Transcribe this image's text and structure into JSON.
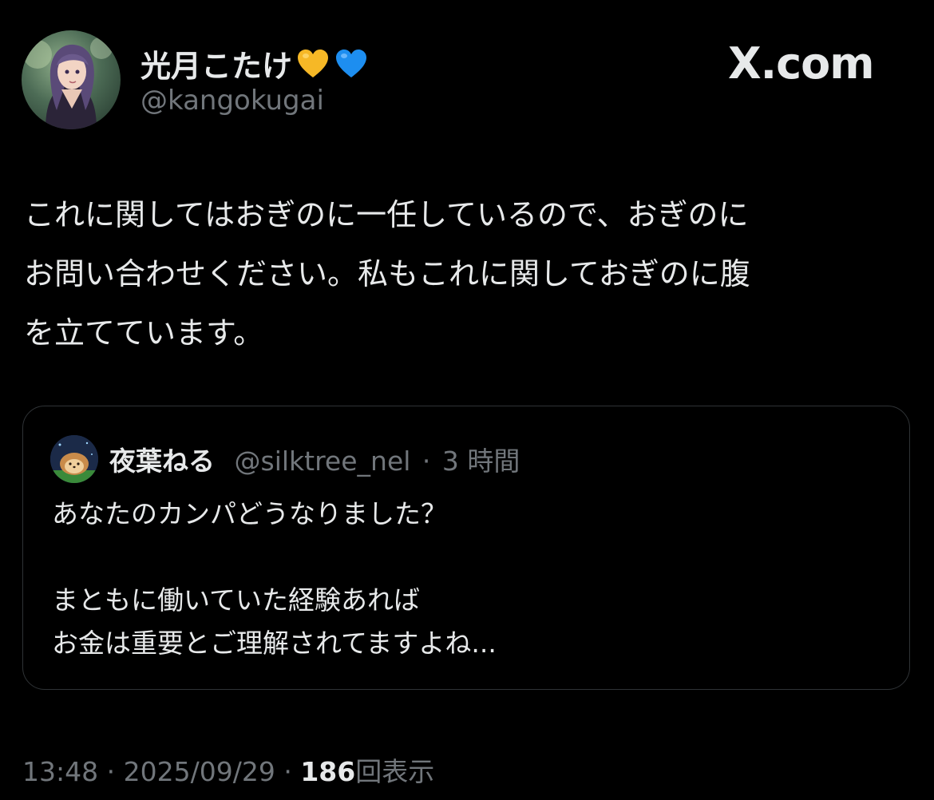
{
  "author": {
    "display_name": "光月こたけ",
    "handle": "@kangokugai",
    "avatar_icon": "avatar-portrait",
    "badges": [
      "yellow-heart-icon",
      "blue-heart-icon"
    ]
  },
  "brand": {
    "label": "X.com"
  },
  "tweet": {
    "lines": [
      "これに関してはおぎのに一任しているので、おぎのに",
      "お問い合わせください。私もこれに関しておぎのに腹",
      "を立てています。"
    ]
  },
  "quoted_tweet": {
    "display_name": "夜葉ねる",
    "handle": "@silktree_nel",
    "separator": "·",
    "time": "3 時間",
    "lines": [
      "あなたのカンパどうなりました？",
      "",
      "まともに働いていた経験あれば",
      "お金は重要とご理解されてますよね..."
    ]
  },
  "footer": {
    "time": "13:48",
    "separator": "·",
    "date": "2025/09/29",
    "views_count": "186",
    "views_label": "回表示"
  },
  "colors": {
    "background": "#000000",
    "primary_text": "#e7e9ea",
    "secondary_text": "#71767b",
    "border": "#2f3336",
    "yellow_heart": "#f6b826",
    "blue_heart": "#1d8ef0"
  }
}
